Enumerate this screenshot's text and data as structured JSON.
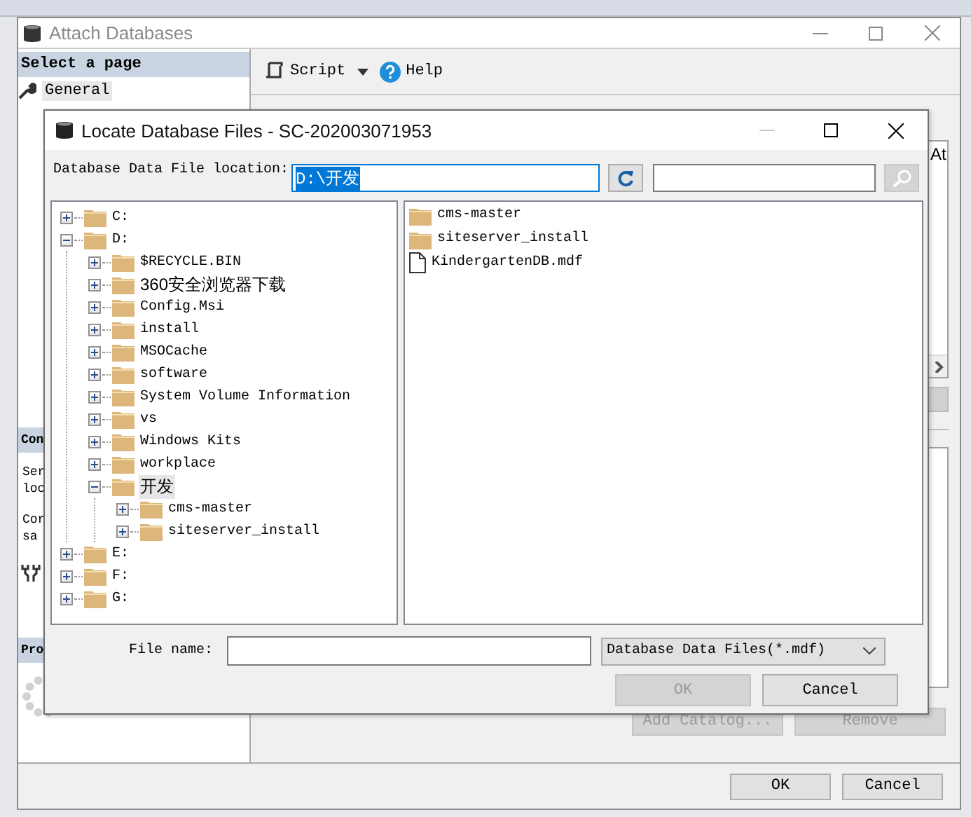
{
  "attach_window": {
    "title": "Attach Databases",
    "pages_header": "Select a page",
    "pages": [
      {
        "label": "General",
        "selected": true
      }
    ],
    "toolbar": [
      {
        "kind": "script",
        "label": "Script"
      },
      {
        "kind": "help",
        "label": "Help"
      }
    ],
    "connection_header": "Con",
    "connection_lines": [
      "Ser",
      "loc",
      "Cor",
      "sa"
    ],
    "progress_header": "Pro",
    "grid_header_fragment": "At",
    "actions": [
      {
        "label": "Add Catalog...",
        "disabled": true
      },
      {
        "label": "Remove",
        "disabled": true
      }
    ],
    "footer_buttons": [
      {
        "label": "OK",
        "disabled": false
      },
      {
        "label": "Cancel",
        "disabled": false
      }
    ]
  },
  "locate_dialog": {
    "title": "Locate Database Files - SC-202003071953",
    "location_label": "Database Data File location:",
    "location_value": "D:\\开发",
    "tree": [
      {
        "label": "C:",
        "expanded": false,
        "selected": false
      },
      {
        "label": "D:",
        "expanded": true,
        "selected": false,
        "children": [
          {
            "label": "$RECYCLE.BIN",
            "expanded": false,
            "selected": false
          },
          {
            "label": "360安全浏览器下载",
            "expanded": false,
            "selected": false
          },
          {
            "label": "Config.Msi",
            "expanded": false,
            "selected": false
          },
          {
            "label": "install",
            "expanded": false,
            "selected": false
          },
          {
            "label": "MSOCache",
            "expanded": false,
            "selected": false
          },
          {
            "label": "software",
            "expanded": false,
            "selected": false
          },
          {
            "label": "System Volume Information",
            "expanded": false,
            "selected": false
          },
          {
            "label": "vs",
            "expanded": false,
            "selected": false
          },
          {
            "label": "Windows Kits",
            "expanded": false,
            "selected": false
          },
          {
            "label": "workplace",
            "expanded": false,
            "selected": false
          },
          {
            "label": "开发",
            "expanded": true,
            "selected": true,
            "children": [
              {
                "label": "cms-master",
                "expanded": false,
                "selected": false
              },
              {
                "label": "siteserver_install",
                "expanded": false,
                "selected": false
              }
            ]
          }
        ]
      },
      {
        "label": "E:",
        "expanded": false,
        "selected": false
      },
      {
        "label": "F:",
        "expanded": false,
        "selected": false
      },
      {
        "label": "G:",
        "expanded": false,
        "selected": false
      }
    ],
    "files": [
      {
        "name": "cms-master",
        "kind": "folder"
      },
      {
        "name": "siteserver_install",
        "kind": "folder"
      },
      {
        "name": "KindergartenDB.mdf",
        "kind": "file"
      }
    ],
    "file_name_label": "File name:",
    "file_type": "Database Data Files(*.mdf)",
    "buttons": [
      {
        "label": "OK",
        "disabled": true
      },
      {
        "label": "Cancel",
        "disabled": false
      }
    ]
  }
}
